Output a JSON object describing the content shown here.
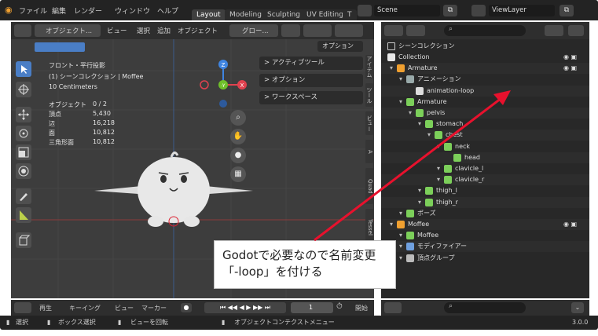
{
  "app": {
    "menu": [
      "ファイル",
      "編集",
      "レンダー",
      "ウィンドウ",
      "ヘルプ"
    ],
    "workspaces": [
      "Layout",
      "Modeling",
      "Sculpting",
      "UV Editing",
      "T"
    ],
    "active_workspace": "Layout",
    "scene": "Scene",
    "view_layer": "ViewLayer"
  },
  "viewport_header": {
    "mode": "オブジェクト...",
    "view": "ビュー",
    "select": "選択",
    "add": "追加",
    "object": "オブジェクト",
    "orientation": "グロー...",
    "options": "オプション"
  },
  "viewport_overlay": {
    "view_name": "フロント・平行投影",
    "collection": "(1) シーンコレクション | Moffee",
    "scale": "10 Centimeters",
    "stats": [
      {
        "label": "オブジェクト",
        "value": "0 / 2"
      },
      {
        "label": "頂点",
        "value": "5,430"
      },
      {
        "label": "辺",
        "value": "16,218"
      },
      {
        "label": "面",
        "value": "10,812"
      },
      {
        "label": "三角形面",
        "value": "10,812"
      }
    ]
  },
  "gizmo": {
    "z": "Z",
    "y": "-Y",
    "x": "X"
  },
  "side_panel": [
    "> アクティブツール",
    "> オプション",
    "> ワークスペース"
  ],
  "side_tabs": [
    "アイテム",
    "ツール",
    "ビュー",
    "A",
    "Quad",
    "Tessel"
  ],
  "outliner": {
    "header": "シーンコレクション",
    "rows": [
      {
        "label": "Collection",
        "indent": 0
      },
      {
        "label": "Armature",
        "indent": 1
      },
      {
        "label": "アニメーション",
        "indent": 2
      },
      {
        "label": "animation-loop",
        "indent": 3
      },
      {
        "label": "Armature",
        "indent": 2
      },
      {
        "label": "pelvis",
        "indent": 3
      },
      {
        "label": "stomach",
        "indent": 4
      },
      {
        "label": "chest",
        "indent": 5
      },
      {
        "label": "neck",
        "indent": 6
      },
      {
        "label": "head",
        "indent": 7
      },
      {
        "label": "clavicle_l",
        "indent": 6
      },
      {
        "label": "clavicle_r",
        "indent": 6
      },
      {
        "label": "thigh_l",
        "indent": 4
      },
      {
        "label": "thigh_r",
        "indent": 4
      },
      {
        "label": "ポーズ",
        "indent": 2
      },
      {
        "label": "Moffee",
        "indent": 1
      },
      {
        "label": "Moffee",
        "indent": 2
      },
      {
        "label": "モディファイアー",
        "indent": 2
      },
      {
        "label": "頂点グループ",
        "indent": 2
      }
    ]
  },
  "timeline": {
    "playback": "再生",
    "keying": "キーイング",
    "view": "ビュー",
    "marker": "マーカー",
    "current_frame": "1",
    "start_label": "開始"
  },
  "statusbar": {
    "select": "選択",
    "box_select": "ボックス選択",
    "rotate_view": "ビューを回転",
    "context_menu": "オブジェクトコンテクストメニュー",
    "version": "3.0.0"
  },
  "annotation": {
    "line1": "Godotで必要なので名前変更",
    "line2": "「-loop」を付ける"
  },
  "colors": {
    "accent": "#4a7ec6",
    "arrow": "#e8112d",
    "gizmo_x": "#e0424f",
    "gizmo_y": "#6fbf2a",
    "gizmo_z": "#3f84e0",
    "bone_green": "#7ccf5a"
  }
}
